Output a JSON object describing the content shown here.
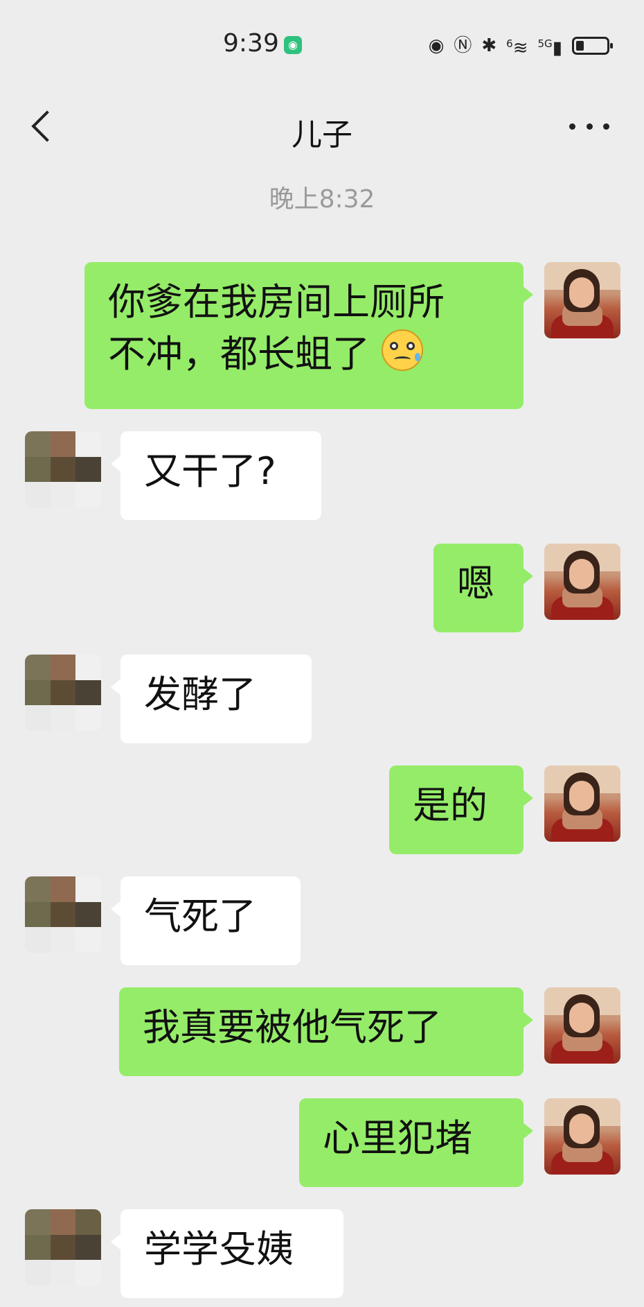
{
  "status_bar": {
    "time": "9:39",
    "app_badge_icon": "app-badge-icon",
    "icons": [
      "eye-icon",
      "nfc-icon",
      "bluetooth-icon",
      "wifi-icon",
      "signal-5g-icon",
      "battery-icon"
    ],
    "wifi_tag": "6",
    "network_label": "5G",
    "battery_level": 0.25
  },
  "header": {
    "title": "儿子",
    "back_icon": "back-arrow-icon",
    "more_icon": "more-icon"
  },
  "timestamp": "晚上8:32",
  "messages": [
    {
      "sender": "me",
      "lines": [
        "你爹在我房间上厕所",
        "不冲，都长蛆了"
      ],
      "emoji": "woozy-face-icon"
    },
    {
      "sender": "partner",
      "text": "又干了?"
    },
    {
      "sender": "me",
      "text": "嗯"
    },
    {
      "sender": "partner",
      "text": "发酵了"
    },
    {
      "sender": "me",
      "text": "是的"
    },
    {
      "sender": "partner",
      "text": "气死了"
    },
    {
      "sender": "me",
      "text": "我真要被他气死了"
    },
    {
      "sender": "me",
      "text": "心里犯堵"
    },
    {
      "sender": "partner",
      "text": "学学殳姨"
    }
  ],
  "colors": {
    "background": "#ededed",
    "outgoing_bubble": "#95ec69",
    "incoming_bubble": "#ffffff",
    "timestamp_text": "#9a9a9a"
  }
}
